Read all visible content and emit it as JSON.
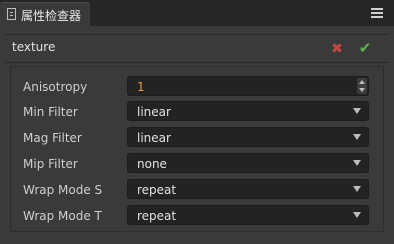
{
  "tab": {
    "title": "属性检查器",
    "icon": "document-icon"
  },
  "menu_icon": "hamburger-menu-icon",
  "header": {
    "title": "texture",
    "revert_icon": "✖",
    "apply_icon": "✔",
    "colors": {
      "revert": "#c8463c",
      "apply": "#5db34a"
    }
  },
  "properties": [
    {
      "label": "Anisotropy",
      "type": "number",
      "value": "1"
    },
    {
      "label": "Min Filter",
      "type": "select",
      "value": "linear"
    },
    {
      "label": "Mag Filter",
      "type": "select",
      "value": "linear"
    },
    {
      "label": "Mip Filter",
      "type": "select",
      "value": "none"
    },
    {
      "label": "Wrap Mode S",
      "type": "select",
      "value": "repeat"
    },
    {
      "label": "Wrap Mode T",
      "type": "select",
      "value": "repeat"
    }
  ],
  "colors": {
    "background": "#3a3a3a",
    "tabbar": "#262626",
    "field_bg": "#232323",
    "number_value": "#e89a36"
  }
}
